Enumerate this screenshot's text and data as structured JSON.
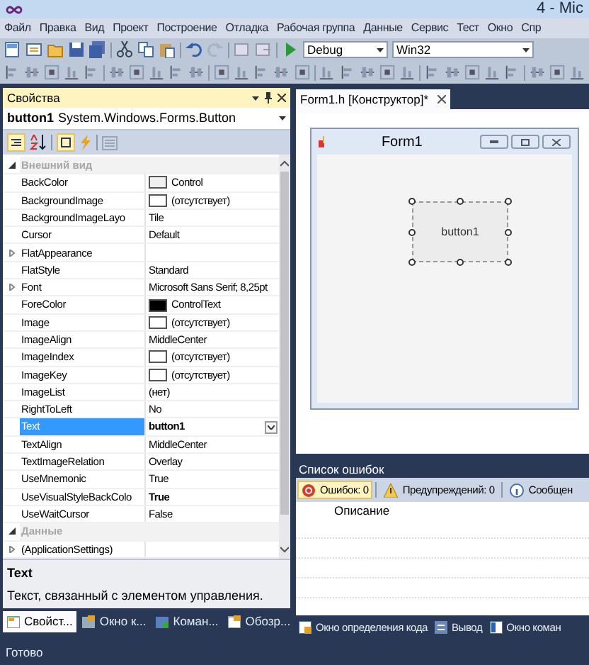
{
  "window": {
    "title": "4 - Mic"
  },
  "menu": [
    "Файл",
    "Правка",
    "Вид",
    "Проект",
    "Построение",
    "Отладка",
    "Рабочая группа",
    "Данные",
    "Сервис",
    "Тест",
    "Окно",
    "Спр"
  ],
  "toolbar": {
    "configuration": "Debug",
    "platform": "Win32"
  },
  "properties_panel": {
    "title": "Свойства",
    "object_name": "button1",
    "object_type": "System.Windows.Forms.Button",
    "rows": [
      {
        "kind": "category",
        "name": "Внешний вид",
        "expanded": true
      },
      {
        "kind": "property",
        "name": "BackColor",
        "value": "Control",
        "color": "#f0f0f0"
      },
      {
        "kind": "property",
        "name": "BackgroundImage",
        "value": "(отсутствует)",
        "color": "#ffffff"
      },
      {
        "kind": "property",
        "name": "BackgroundImageLayo",
        "value": "Tile"
      },
      {
        "kind": "property",
        "name": "Cursor",
        "value": "Default"
      },
      {
        "kind": "property",
        "name": "FlatAppearance",
        "value": "",
        "expanded": false
      },
      {
        "kind": "property",
        "name": "FlatStyle",
        "value": "Standard"
      },
      {
        "kind": "property",
        "name": "Font",
        "value": "Microsoft Sans Serif; 8,25pt",
        "expanded": false
      },
      {
        "kind": "property",
        "name": "ForeColor",
        "value": "ControlText",
        "color": "#000000"
      },
      {
        "kind": "property",
        "name": "Image",
        "value": "(отсутствует)",
        "color": "#ffffff"
      },
      {
        "kind": "property",
        "name": "ImageAlign",
        "value": "MiddleCenter"
      },
      {
        "kind": "property",
        "name": "ImageIndex",
        "value": "(отсутствует)",
        "color": "#ffffff"
      },
      {
        "kind": "property",
        "name": "ImageKey",
        "value": "(отсутствует)",
        "color": "#ffffff"
      },
      {
        "kind": "property",
        "name": "ImageList",
        "value": "(нет)"
      },
      {
        "kind": "property",
        "name": "RightToLeft",
        "value": "No"
      },
      {
        "kind": "property",
        "name": "Text",
        "value": "button1",
        "modified": true,
        "selected": true
      },
      {
        "kind": "property",
        "name": "TextAlign",
        "value": "MiddleCenter"
      },
      {
        "kind": "property",
        "name": "TextImageRelation",
        "value": "Overlay"
      },
      {
        "kind": "property",
        "name": "UseMnemonic",
        "value": "True"
      },
      {
        "kind": "property",
        "name": "UseVisualStyleBackColo",
        "value": "True",
        "modified": true
      },
      {
        "kind": "property",
        "name": "UseWaitCursor",
        "value": "False"
      },
      {
        "kind": "category",
        "name": "Данные",
        "expanded": true
      },
      {
        "kind": "property",
        "name": "(ApplicationSettings)",
        "value": "",
        "expanded": false
      }
    ],
    "description": {
      "title": "Text",
      "text": "Текст, связанный с элементом управления."
    }
  },
  "left_tabs": [
    {
      "label": "Свойст...",
      "selected": true
    },
    {
      "label": "Окно к...",
      "selected": false
    },
    {
      "label": "Коман...",
      "selected": false
    },
    {
      "label": "Обозр...",
      "selected": false
    }
  ],
  "document_tab": {
    "label": "Form1.h [Конструктор]*"
  },
  "form": {
    "title": "Form1",
    "button": "button1"
  },
  "error_list": {
    "title": "Список ошибок",
    "filters": [
      {
        "label": "Ошибок: 0",
        "kind": "error",
        "selected": true
      },
      {
        "label": "Предупреждений: 0",
        "kind": "warning",
        "selected": false
      },
      {
        "label": "Сообщен",
        "kind": "info",
        "selected": false
      }
    ],
    "columns": [
      "Описание"
    ]
  },
  "right_tabs": [
    {
      "label": "Окно определения кода",
      "kind": "code"
    },
    {
      "label": "Вывод",
      "kind": "output"
    },
    {
      "label": "Окно коман",
      "kind": "command"
    }
  ],
  "status_bar": "Готово"
}
